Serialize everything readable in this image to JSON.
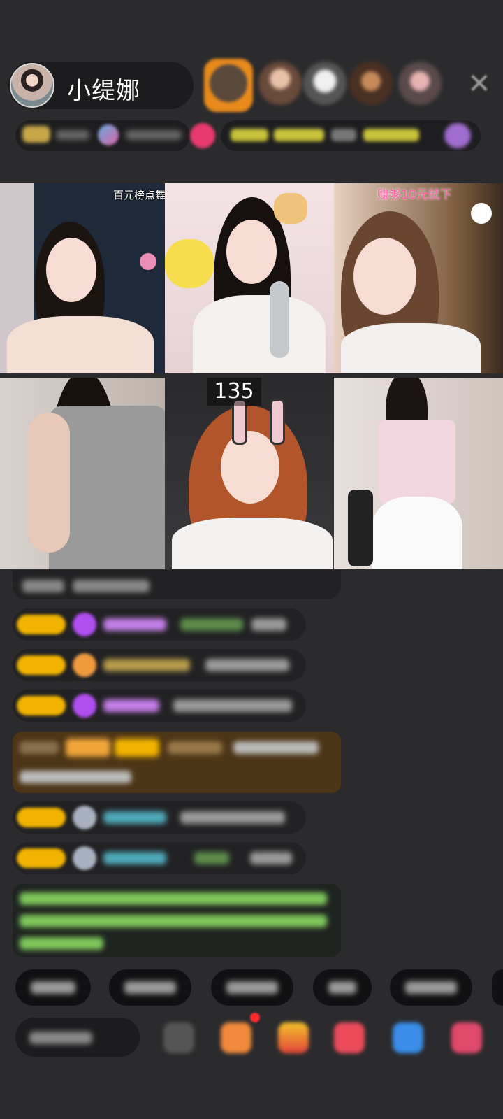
{
  "header": {
    "host_name": "小缇娜",
    "close_icon": "close-icon"
  },
  "grid": {
    "tiles": [
      {
        "caption": "百元榜点舞"
      },
      {
        "caption": ""
      },
      {
        "caption": "赚够10元就下"
      },
      {
        "caption": ""
      },
      {
        "caption": "",
        "score": "135"
      },
      {
        "caption": ""
      }
    ]
  },
  "colors": {
    "background": "#2b2b2d",
    "level_badge": "#f2b300",
    "highlight_message": "#4d3617",
    "notice_message": "#1f2421"
  },
  "icons": [
    "host-avatar",
    "close-icon",
    "diamond-icon",
    "gift-icon",
    "pink-badge-icon"
  ]
}
